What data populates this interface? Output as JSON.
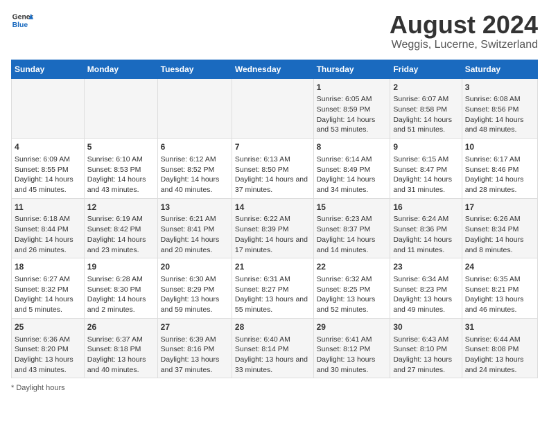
{
  "header": {
    "logo_general": "General",
    "logo_blue": "Blue",
    "main_title": "August 2024",
    "subtitle": "Weggis, Lucerne, Switzerland"
  },
  "calendar": {
    "days_of_week": [
      "Sunday",
      "Monday",
      "Tuesday",
      "Wednesday",
      "Thursday",
      "Friday",
      "Saturday"
    ],
    "weeks": [
      [
        {
          "day": "",
          "info": ""
        },
        {
          "day": "",
          "info": ""
        },
        {
          "day": "",
          "info": ""
        },
        {
          "day": "",
          "info": ""
        },
        {
          "day": "1",
          "info": "Sunrise: 6:05 AM\nSunset: 8:59 PM\nDaylight: 14 hours and 53 minutes."
        },
        {
          "day": "2",
          "info": "Sunrise: 6:07 AM\nSunset: 8:58 PM\nDaylight: 14 hours and 51 minutes."
        },
        {
          "day": "3",
          "info": "Sunrise: 6:08 AM\nSunset: 8:56 PM\nDaylight: 14 hours and 48 minutes."
        }
      ],
      [
        {
          "day": "4",
          "info": "Sunrise: 6:09 AM\nSunset: 8:55 PM\nDaylight: 14 hours and 45 minutes."
        },
        {
          "day": "5",
          "info": "Sunrise: 6:10 AM\nSunset: 8:53 PM\nDaylight: 14 hours and 43 minutes."
        },
        {
          "day": "6",
          "info": "Sunrise: 6:12 AM\nSunset: 8:52 PM\nDaylight: 14 hours and 40 minutes."
        },
        {
          "day": "7",
          "info": "Sunrise: 6:13 AM\nSunset: 8:50 PM\nDaylight: 14 hours and 37 minutes."
        },
        {
          "day": "8",
          "info": "Sunrise: 6:14 AM\nSunset: 8:49 PM\nDaylight: 14 hours and 34 minutes."
        },
        {
          "day": "9",
          "info": "Sunrise: 6:15 AM\nSunset: 8:47 PM\nDaylight: 14 hours and 31 minutes."
        },
        {
          "day": "10",
          "info": "Sunrise: 6:17 AM\nSunset: 8:46 PM\nDaylight: 14 hours and 28 minutes."
        }
      ],
      [
        {
          "day": "11",
          "info": "Sunrise: 6:18 AM\nSunset: 8:44 PM\nDaylight: 14 hours and 26 minutes."
        },
        {
          "day": "12",
          "info": "Sunrise: 6:19 AM\nSunset: 8:42 PM\nDaylight: 14 hours and 23 minutes."
        },
        {
          "day": "13",
          "info": "Sunrise: 6:21 AM\nSunset: 8:41 PM\nDaylight: 14 hours and 20 minutes."
        },
        {
          "day": "14",
          "info": "Sunrise: 6:22 AM\nSunset: 8:39 PM\nDaylight: 14 hours and 17 minutes."
        },
        {
          "day": "15",
          "info": "Sunrise: 6:23 AM\nSunset: 8:37 PM\nDaylight: 14 hours and 14 minutes."
        },
        {
          "day": "16",
          "info": "Sunrise: 6:24 AM\nSunset: 8:36 PM\nDaylight: 14 hours and 11 minutes."
        },
        {
          "day": "17",
          "info": "Sunrise: 6:26 AM\nSunset: 8:34 PM\nDaylight: 14 hours and 8 minutes."
        }
      ],
      [
        {
          "day": "18",
          "info": "Sunrise: 6:27 AM\nSunset: 8:32 PM\nDaylight: 14 hours and 5 minutes."
        },
        {
          "day": "19",
          "info": "Sunrise: 6:28 AM\nSunset: 8:30 PM\nDaylight: 14 hours and 2 minutes."
        },
        {
          "day": "20",
          "info": "Sunrise: 6:30 AM\nSunset: 8:29 PM\nDaylight: 13 hours and 59 minutes."
        },
        {
          "day": "21",
          "info": "Sunrise: 6:31 AM\nSunset: 8:27 PM\nDaylight: 13 hours and 55 minutes."
        },
        {
          "day": "22",
          "info": "Sunrise: 6:32 AM\nSunset: 8:25 PM\nDaylight: 13 hours and 52 minutes."
        },
        {
          "day": "23",
          "info": "Sunrise: 6:34 AM\nSunset: 8:23 PM\nDaylight: 13 hours and 49 minutes."
        },
        {
          "day": "24",
          "info": "Sunrise: 6:35 AM\nSunset: 8:21 PM\nDaylight: 13 hours and 46 minutes."
        }
      ],
      [
        {
          "day": "25",
          "info": "Sunrise: 6:36 AM\nSunset: 8:20 PM\nDaylight: 13 hours and 43 minutes."
        },
        {
          "day": "26",
          "info": "Sunrise: 6:37 AM\nSunset: 8:18 PM\nDaylight: 13 hours and 40 minutes."
        },
        {
          "day": "27",
          "info": "Sunrise: 6:39 AM\nSunset: 8:16 PM\nDaylight: 13 hours and 37 minutes."
        },
        {
          "day": "28",
          "info": "Sunrise: 6:40 AM\nSunset: 8:14 PM\nDaylight: 13 hours and 33 minutes."
        },
        {
          "day": "29",
          "info": "Sunrise: 6:41 AM\nSunset: 8:12 PM\nDaylight: 13 hours and 30 minutes."
        },
        {
          "day": "30",
          "info": "Sunrise: 6:43 AM\nSunset: 8:10 PM\nDaylight: 13 hours and 27 minutes."
        },
        {
          "day": "31",
          "info": "Sunrise: 6:44 AM\nSunset: 8:08 PM\nDaylight: 13 hours and 24 minutes."
        }
      ]
    ]
  },
  "footer": {
    "note": "Daylight hours"
  }
}
